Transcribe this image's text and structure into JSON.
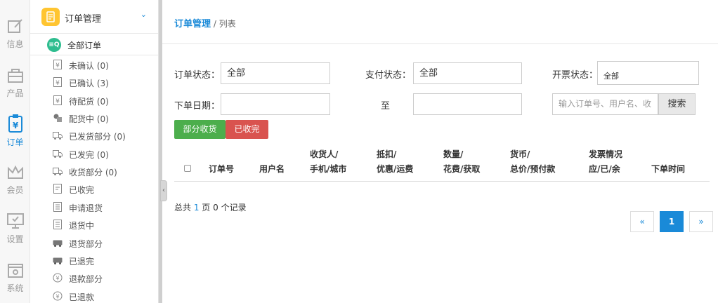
{
  "rail": {
    "items": [
      {
        "label": "信息",
        "icon": "edit-icon"
      },
      {
        "label": "产品",
        "icon": "bag-icon"
      },
      {
        "label": "订单",
        "icon": "order-icon"
      },
      {
        "label": "会员",
        "icon": "crown-icon"
      },
      {
        "label": "设置",
        "icon": "monitor-icon"
      },
      {
        "label": "系统",
        "icon": "system-gear-icon"
      }
    ],
    "active_color": "#1a8ad8"
  },
  "sidebar": {
    "header": "订单管理",
    "all_orders_icon_text": "≡Q",
    "all_orders": "全部订单",
    "items": [
      {
        "label": "未确认 (0)",
        "icon": "yen-doc-icon"
      },
      {
        "label": "已确认 (3)",
        "icon": "yen-doc-icon"
      },
      {
        "label": "待配货 (0)",
        "icon": "yen-doc-icon"
      },
      {
        "label": "配货中 (0)",
        "icon": "boxes-icon"
      },
      {
        "label": "已发货部分 (0)",
        "icon": "truck-icon"
      },
      {
        "label": "已发完 (0)",
        "icon": "truck-icon"
      },
      {
        "label": "收货部分 (0)",
        "icon": "truck-icon"
      },
      {
        "label": "已收完",
        "icon": "doc-icon"
      },
      {
        "label": "申请退货",
        "icon": "doc-list-icon"
      },
      {
        "label": "退货中",
        "icon": "doc-list-icon"
      },
      {
        "label": "退货部分",
        "icon": "return-truck-icon"
      },
      {
        "label": "已退完",
        "icon": "return-truck-icon"
      },
      {
        "label": "退款部分",
        "icon": "refund-icon"
      },
      {
        "label": "已退款",
        "icon": "refund-icon"
      }
    ]
  },
  "breadcrumb": {
    "section": "订单管理",
    "separator": " / ",
    "page": "列表"
  },
  "filters": {
    "order_status_label": "订单状态：",
    "order_status_value": "全部",
    "pay_status_label": "支付状态：",
    "pay_status_value": "全部",
    "invoice_status_label": "开票状态：",
    "invoice_status_value": "全部",
    "date_label": "下单日期：",
    "date_to": "至",
    "search_placeholder": "输入订单号、用户名、收",
    "search_button": "搜索"
  },
  "actions": {
    "partial_received": "部分收货",
    "received": "已收完"
  },
  "table": {
    "headers": [
      [
        "订单号"
      ],
      [
        "用户名"
      ],
      [
        "收货人/",
        "手机/城市"
      ],
      [
        "抵扣/",
        "优惠/运费"
      ],
      [
        "数量/",
        "花费/获取"
      ],
      [
        "货币/",
        "总价/预付款"
      ],
      [
        "发票情况",
        "应/已/余"
      ],
      [
        "下单时间"
      ]
    ]
  },
  "pagination": {
    "summary_prefix": "总共 ",
    "total_pages": "1",
    "summary_mid": " 页 ",
    "total_records": "0",
    "summary_suffix": " 个记录",
    "prev": "«",
    "current": "1",
    "next": "»"
  }
}
